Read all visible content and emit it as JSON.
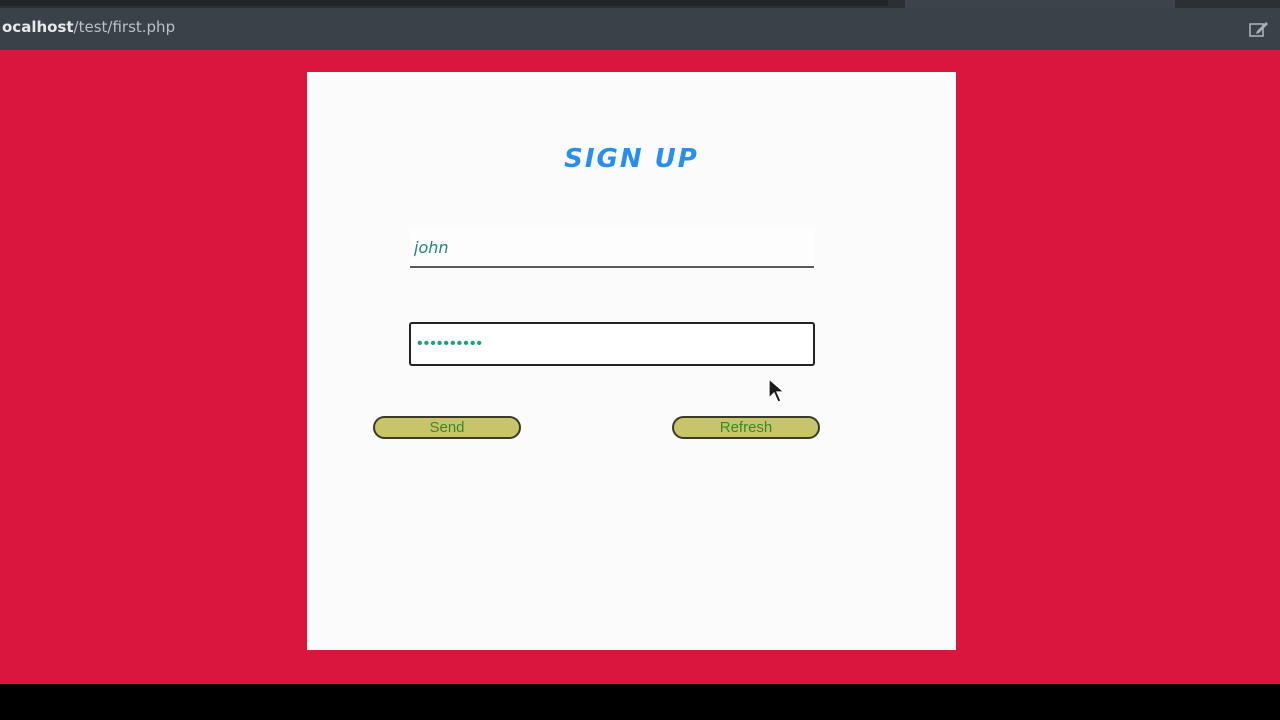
{
  "browser": {
    "url_host": "ocalhost",
    "url_path": "/test/first.php"
  },
  "form": {
    "title": "SIGN UP",
    "username_value": "john",
    "password_value": "••••••••••",
    "send_label": "Send",
    "refresh_label": "Refresh"
  },
  "colors": {
    "background": "#d9163c",
    "card": "#fcfbfb",
    "title": "#2a8ef0",
    "button": "#c7c46a",
    "button_text": "#3a8a2a"
  },
  "icons": {
    "edit": "edit-icon",
    "cursor": "mouse-cursor-icon"
  }
}
